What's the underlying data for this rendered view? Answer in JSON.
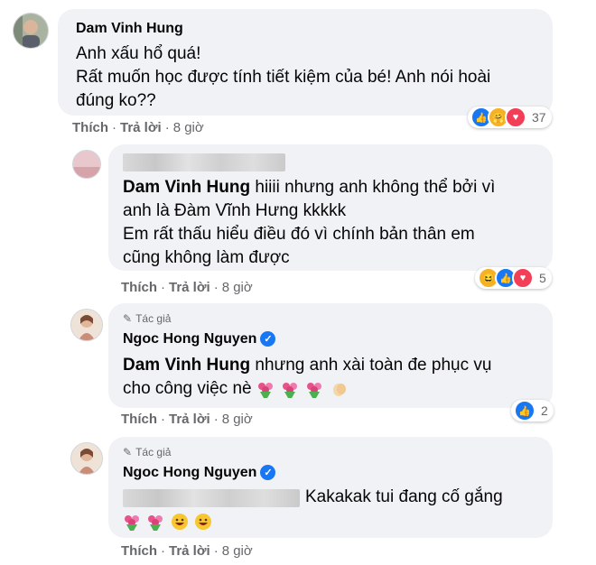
{
  "comments": [
    {
      "author": "Dam Vinh Hung",
      "lines": [
        "Anh xấu hổ quá!",
        "Rất muốn học được tính tiết kiệm của bé! Anh nói hoài",
        "đúng ko??"
      ],
      "actions": {
        "like": "Thích",
        "reply": "Trả lời",
        "time": "8 giờ"
      },
      "reactions": {
        "icons": [
          "like-icon",
          "care-icon",
          "love-icon"
        ],
        "count": "37"
      }
    },
    {
      "author": "",
      "mention": "Dam Vinh Hung",
      "lines": [
        " hiiii nhưng anh không thể bởi vì",
        "anh là Đàm Vĩnh Hưng kkkkk",
        "Em rất thấu hiểu điều đó vì chính bản thân em",
        "cũng không làm được"
      ],
      "actions": {
        "like": "Thích",
        "reply": "Trả lời",
        "time": "8 giờ"
      },
      "reactions": {
        "icons": [
          "haha-icon",
          "like-icon",
          "love-icon"
        ],
        "count": "5"
      }
    },
    {
      "badge": "Tác giả",
      "author": "Ngoc Hong Nguyen",
      "mention": "Dam Vinh Hung",
      "lines": [
        " nhưng anh xài toàn đe phục vụ",
        "cho công việc nè"
      ],
      "actions": {
        "like": "Thích",
        "reply": "Trả lời",
        "time": "8 giờ"
      },
      "reactions": {
        "icons": [
          "like-icon"
        ],
        "count": "2"
      }
    },
    {
      "badge": "Tác giả",
      "author": "Ngoc Hong Nguyen",
      "lines": [
        "Kakakak tui đang cố gắng"
      ],
      "actions": {
        "like": "Thích",
        "reply": "Trả lời",
        "time": "8 giờ"
      }
    }
  ],
  "colors": {
    "bubble": "#f0f2f5",
    "meta": "#65676b",
    "like": "#1877f2",
    "love": "#f33e58"
  }
}
